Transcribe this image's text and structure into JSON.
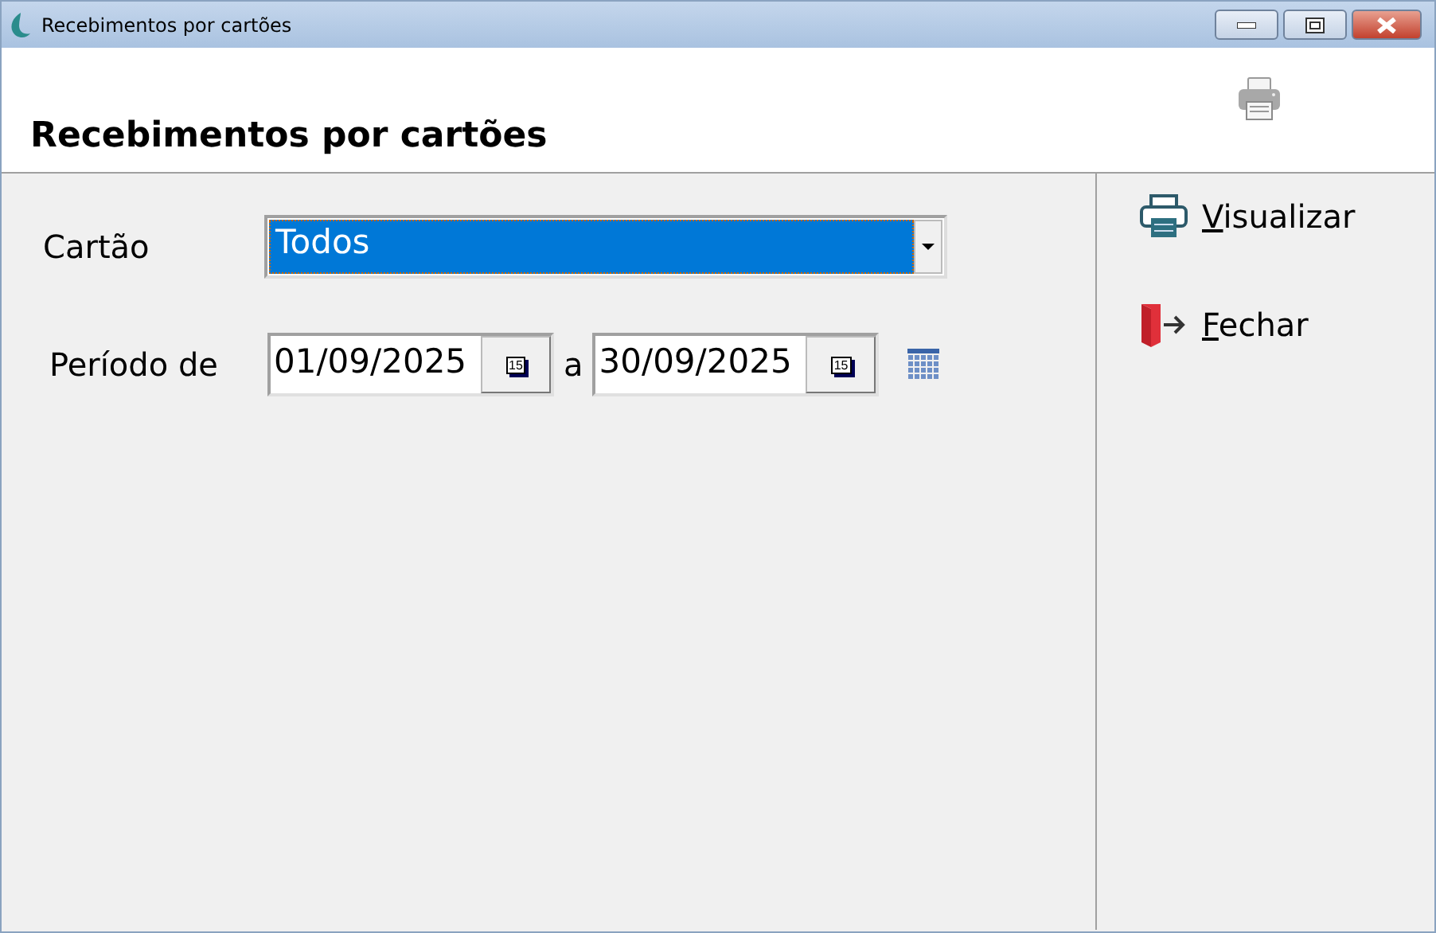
{
  "window": {
    "title": "Recebimentos por cartões"
  },
  "header": {
    "title": "Recebimentos por cartões"
  },
  "filters": {
    "card": {
      "label": "Cartão",
      "value": "Todos",
      "highlighted": true
    },
    "period": {
      "label": "Período de",
      "from": "01/09/2025",
      "from_calendar_badge": "15",
      "separator": "a",
      "to": "30/09/2025",
      "to_calendar_badge": "15"
    }
  },
  "actions": [
    {
      "kind": "printer",
      "label": "Visualizar"
    },
    {
      "kind": "exit",
      "label": "Fechar"
    }
  ]
}
